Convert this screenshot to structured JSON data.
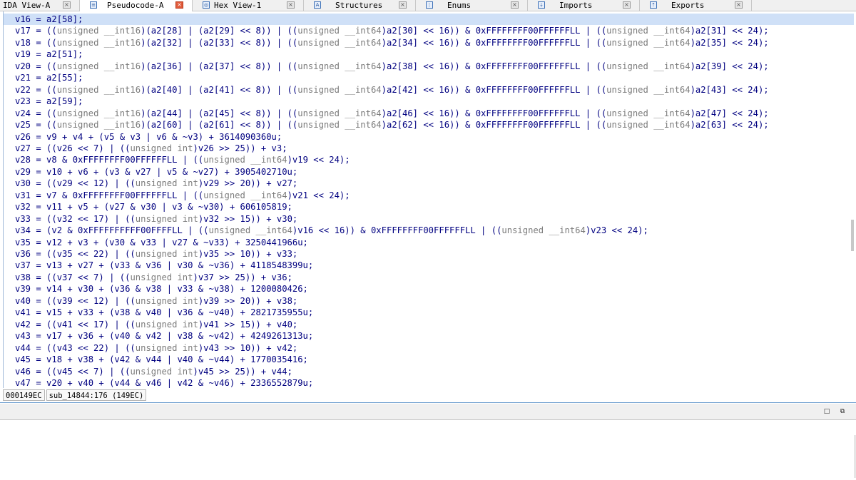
{
  "tabs": [
    {
      "label": "IDA View-A",
      "icon": "",
      "active": false
    },
    {
      "label": "Pseudocode-A",
      "icon": "pseudocode-icon",
      "active": true
    },
    {
      "label": "Hex View-1",
      "icon": "hex-icon",
      "active": false
    },
    {
      "label": "Structures",
      "icon": "structures-icon",
      "active": false
    },
    {
      "label": "Enums",
      "icon": "enums-icon",
      "active": false
    },
    {
      "label": "Imports",
      "icon": "imports-icon",
      "active": false
    },
    {
      "label": "Exports",
      "icon": "exports-icon",
      "active": false
    }
  ],
  "tab_close_glyph": "×",
  "code_lines": [
    "v16 = a2[58];",
    "v17 = ((unsigned __int16)(a2[28] | (a2[29] << 8)) | ((unsigned __int64)a2[30] << 16)) & 0xFFFFFFFF00FFFFFFLL | ((unsigned __int64)a2[31] << 24);",
    "v18 = ((unsigned __int16)(a2[32] | (a2[33] << 8)) | ((unsigned __int64)a2[34] << 16)) & 0xFFFFFFFF00FFFFFFLL | ((unsigned __int64)a2[35] << 24);",
    "v19 = a2[51];",
    "v20 = ((unsigned __int16)(a2[36] | (a2[37] << 8)) | ((unsigned __int64)a2[38] << 16)) & 0xFFFFFFFF00FFFFFFLL | ((unsigned __int64)a2[39] << 24);",
    "v21 = a2[55];",
    "v22 = ((unsigned __int16)(a2[40] | (a2[41] << 8)) | ((unsigned __int64)a2[42] << 16)) & 0xFFFFFFFF00FFFFFFLL | ((unsigned __int64)a2[43] << 24);",
    "v23 = a2[59];",
    "v24 = ((unsigned __int16)(a2[44] | (a2[45] << 8)) | ((unsigned __int64)a2[46] << 16)) & 0xFFFFFFFF00FFFFFFLL | ((unsigned __int64)a2[47] << 24);",
    "v25 = ((unsigned __int16)(a2[60] | (a2[61] << 8)) | ((unsigned __int64)a2[62] << 16)) & 0xFFFFFFFF00FFFFFFLL | ((unsigned __int64)a2[63] << 24);",
    "v26 = v9 + v4 + (v5 & v3 | v6 & ~v3) + 3614090360u;",
    "v27 = ((v26 << 7) | ((unsigned int)v26 >> 25)) + v3;",
    "v28 = v8 & 0xFFFFFFFF00FFFFFFLL | ((unsigned __int64)v19 << 24);",
    "v29 = v10 + v6 + (v3 & v27 | v5 & ~v27) + 3905402710u;",
    "v30 = ((v29 << 12) | ((unsigned int)v29 >> 20)) + v27;",
    "v31 = v7 & 0xFFFFFFFF00FFFFFFLL | ((unsigned __int64)v21 << 24);",
    "v32 = v11 + v5 + (v27 & v30 | v3 & ~v30) + 606105819;",
    "v33 = ((v32 << 17) | ((unsigned int)v32 >> 15)) + v30;",
    "v34 = (v2 & 0xFFFFFFFFFF00FFFFLL | ((unsigned __int64)v16 << 16)) & 0xFFFFFFFF00FFFFFFLL | ((unsigned __int64)v23 << 24);",
    "v35 = v12 + v3 + (v30 & v33 | v27 & ~v33) + 3250441966u;",
    "v36 = ((v35 << 22) | ((unsigned int)v35 >> 10)) + v33;",
    "v37 = v13 + v27 + (v33 & v36 | v30 & ~v36) + 4118548399u;",
    "v38 = ((v37 << 7) | ((unsigned int)v37 >> 25)) + v36;",
    "v39 = v14 + v30 + (v36 & v38 | v33 & ~v38) + 1200080426;",
    "v40 = ((v39 << 12) | ((unsigned int)v39 >> 20)) + v38;",
    "v41 = v15 + v33 + (v38 & v40 | v36 & ~v40) + 2821735955u;",
    "v42 = ((v41 << 17) | ((unsigned int)v41 >> 15)) + v40;",
    "v43 = v17 + v36 + (v40 & v42 | v38 & ~v42) + 4249261313u;",
    "v44 = ((v43 << 22) | ((unsigned int)v43 >> 10)) + v42;",
    "v45 = v18 + v38 + (v42 & v44 | v40 & ~v44) + 1770035416;",
    "v46 = ((v45 << 7) | ((unsigned int)v45 >> 25)) + v44;",
    "v47 = v20 + v40 + (v44 & v46 | v42 & ~v46) + 2336552879u;"
  ],
  "status": {
    "address": "000149EC",
    "location": "sub_14844:176 (149EC)"
  },
  "lower_pane_buttons": {
    "restore": "□",
    "float": "⧉"
  },
  "colors": {
    "code_text": "#000080",
    "cast_text": "#7b7b7b",
    "highlight": "#cfe0f7",
    "active_close": "#e05a3a"
  }
}
